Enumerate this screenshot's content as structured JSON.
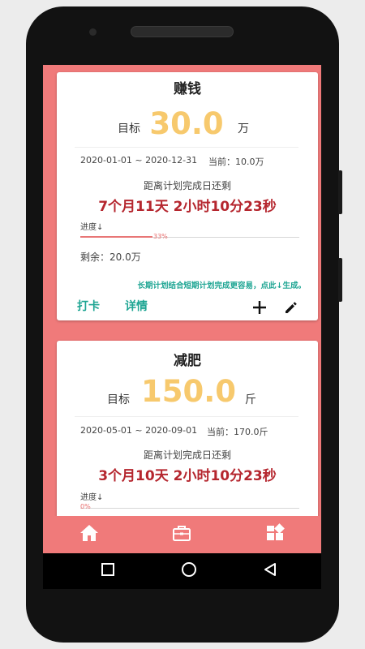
{
  "cards": [
    {
      "title": "赚钱",
      "goal_label": "目标",
      "goal_value": "30.0",
      "goal_unit": "万",
      "dates": "2020-01-01 ~ 2020-12-31",
      "current": "当前：10.0万",
      "remain_label": "距离计划完成日还剩",
      "countdown": "7个月11天  2小时10分23秒",
      "progress_label": "进度↓",
      "progress_percent": 33,
      "progress_text": "33%",
      "remaining": "剩余：20.0万",
      "tip": "长期计划结合短期计划完成更容易，点此↓生成。",
      "checkin_label": "打卡",
      "details_label": "详情"
    },
    {
      "title": "减肥",
      "goal_label": "目标",
      "goal_value": "150.0",
      "goal_unit": "斤",
      "dates": "2020-05-01 ~ 2020-09-01",
      "current": "当前：170.0斤",
      "remain_label": "距离计划完成日还剩",
      "countdown": "3个月10天  2小时10分23秒",
      "progress_label": "进度↓",
      "progress_percent": 0,
      "progress_text": "0%"
    }
  ],
  "nav": {
    "items": [
      "home-icon",
      "briefcase-icon",
      "dashboard-icon"
    ]
  },
  "system": {
    "buttons": [
      "back-icon",
      "home-circle-icon",
      "recents-icon"
    ]
  },
  "colors": {
    "accent": "#f07a7a",
    "goal": "#f7c96d",
    "countdown": "#b5262e",
    "teal": "#1ea593"
  }
}
